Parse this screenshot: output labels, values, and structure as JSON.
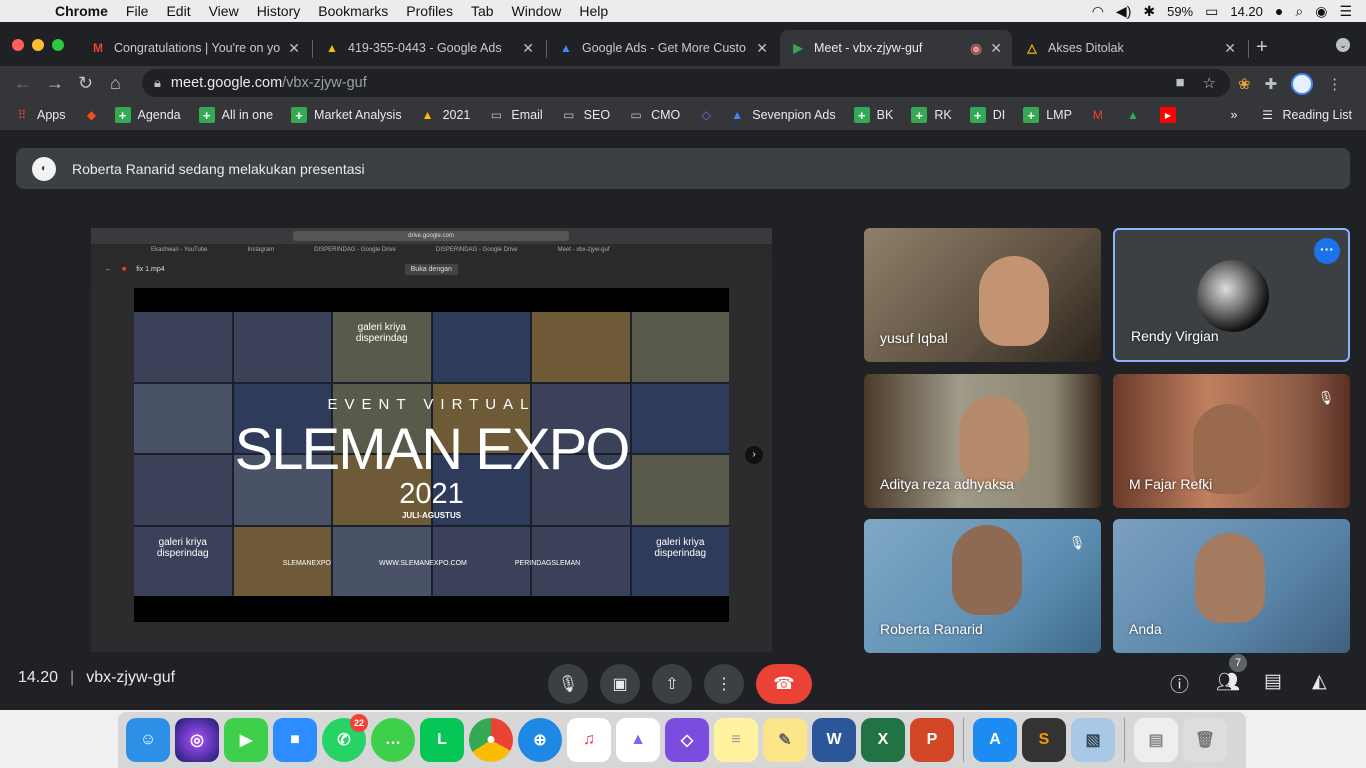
{
  "menubar": {
    "app": "Chrome",
    "items": [
      "File",
      "Edit",
      "View",
      "History",
      "Bookmarks",
      "Profiles",
      "Tab",
      "Window",
      "Help"
    ],
    "battery": "59%",
    "clock": "14.20"
  },
  "tabs": [
    {
      "title": "Congratulations | You're on yo",
      "icon": "gmail-icon",
      "active": false
    },
    {
      "title": "419-355-0443 - Google Ads",
      "icon": "google-ads-icon",
      "active": false
    },
    {
      "title": "Google Ads - Get More Custo",
      "icon": "google-ads-icon",
      "active": false
    },
    {
      "title": "Meet - vbx-zjyw-guf",
      "icon": "meet-icon",
      "active": true
    },
    {
      "title": "Akses Ditolak",
      "icon": "drive-icon",
      "active": false
    }
  ],
  "address": {
    "host": "meet.google.com",
    "path": "/vbx-zjyw-guf"
  },
  "bookmarks": {
    "items": [
      "Apps",
      "Agenda",
      "All in one",
      "Market Analysis",
      "2021",
      "Email",
      "SEO",
      "CMO",
      "Sevenpion Ads",
      "BK",
      "RK",
      "DI",
      "LMP"
    ],
    "reading_list": "Reading List"
  },
  "meet": {
    "banner": "Roberta Ranarid sedang melakukan presentasi",
    "presentation": {
      "drive_url": "drive.google.com",
      "tabs": [
        "Ekashwari - YouTube",
        "Instagram",
        "DISPERINDAG - Google Drive",
        "DISPERINDAG - Google Drive",
        "Meet - vbx-zjyw-guf"
      ],
      "file": "fix 1.mp4",
      "open_with": "Buka dengan",
      "tiles": [
        "galeri kriya disperindag",
        "galeri kriya disperindag",
        "galeri kriya disperindag"
      ],
      "event": "EVENT VIRTUAL",
      "title": "SLEMAN EXPO",
      "year": "2021",
      "dates": "JULI-AGUSTUS",
      "links": [
        "SLEMANEXPO",
        "WWW.SLEMANEXPO.COM",
        "PERINDAGSLEMAN"
      ]
    },
    "participants": [
      {
        "name": "yusuf Iqbal",
        "muted": false
      },
      {
        "name": "Rendy Virgian",
        "muted": false,
        "speaking": true
      },
      {
        "name": "Aditya reza adhyaksa",
        "muted": false
      },
      {
        "name": "M Fajar Refki",
        "muted": true
      },
      {
        "name": "Roberta Ranarid",
        "muted": true
      },
      {
        "name": "Anda",
        "muted": false
      }
    ],
    "bottom": {
      "time": "14.20",
      "separator": "|",
      "code": "vbx-zjyw-guf",
      "participant_count": "7"
    }
  },
  "dock": {
    "whatsapp_badge": "22"
  },
  "colors": {
    "end_call": "#ea4335",
    "active_border": "#8ab4f8",
    "more_button": "#1a73e8"
  }
}
